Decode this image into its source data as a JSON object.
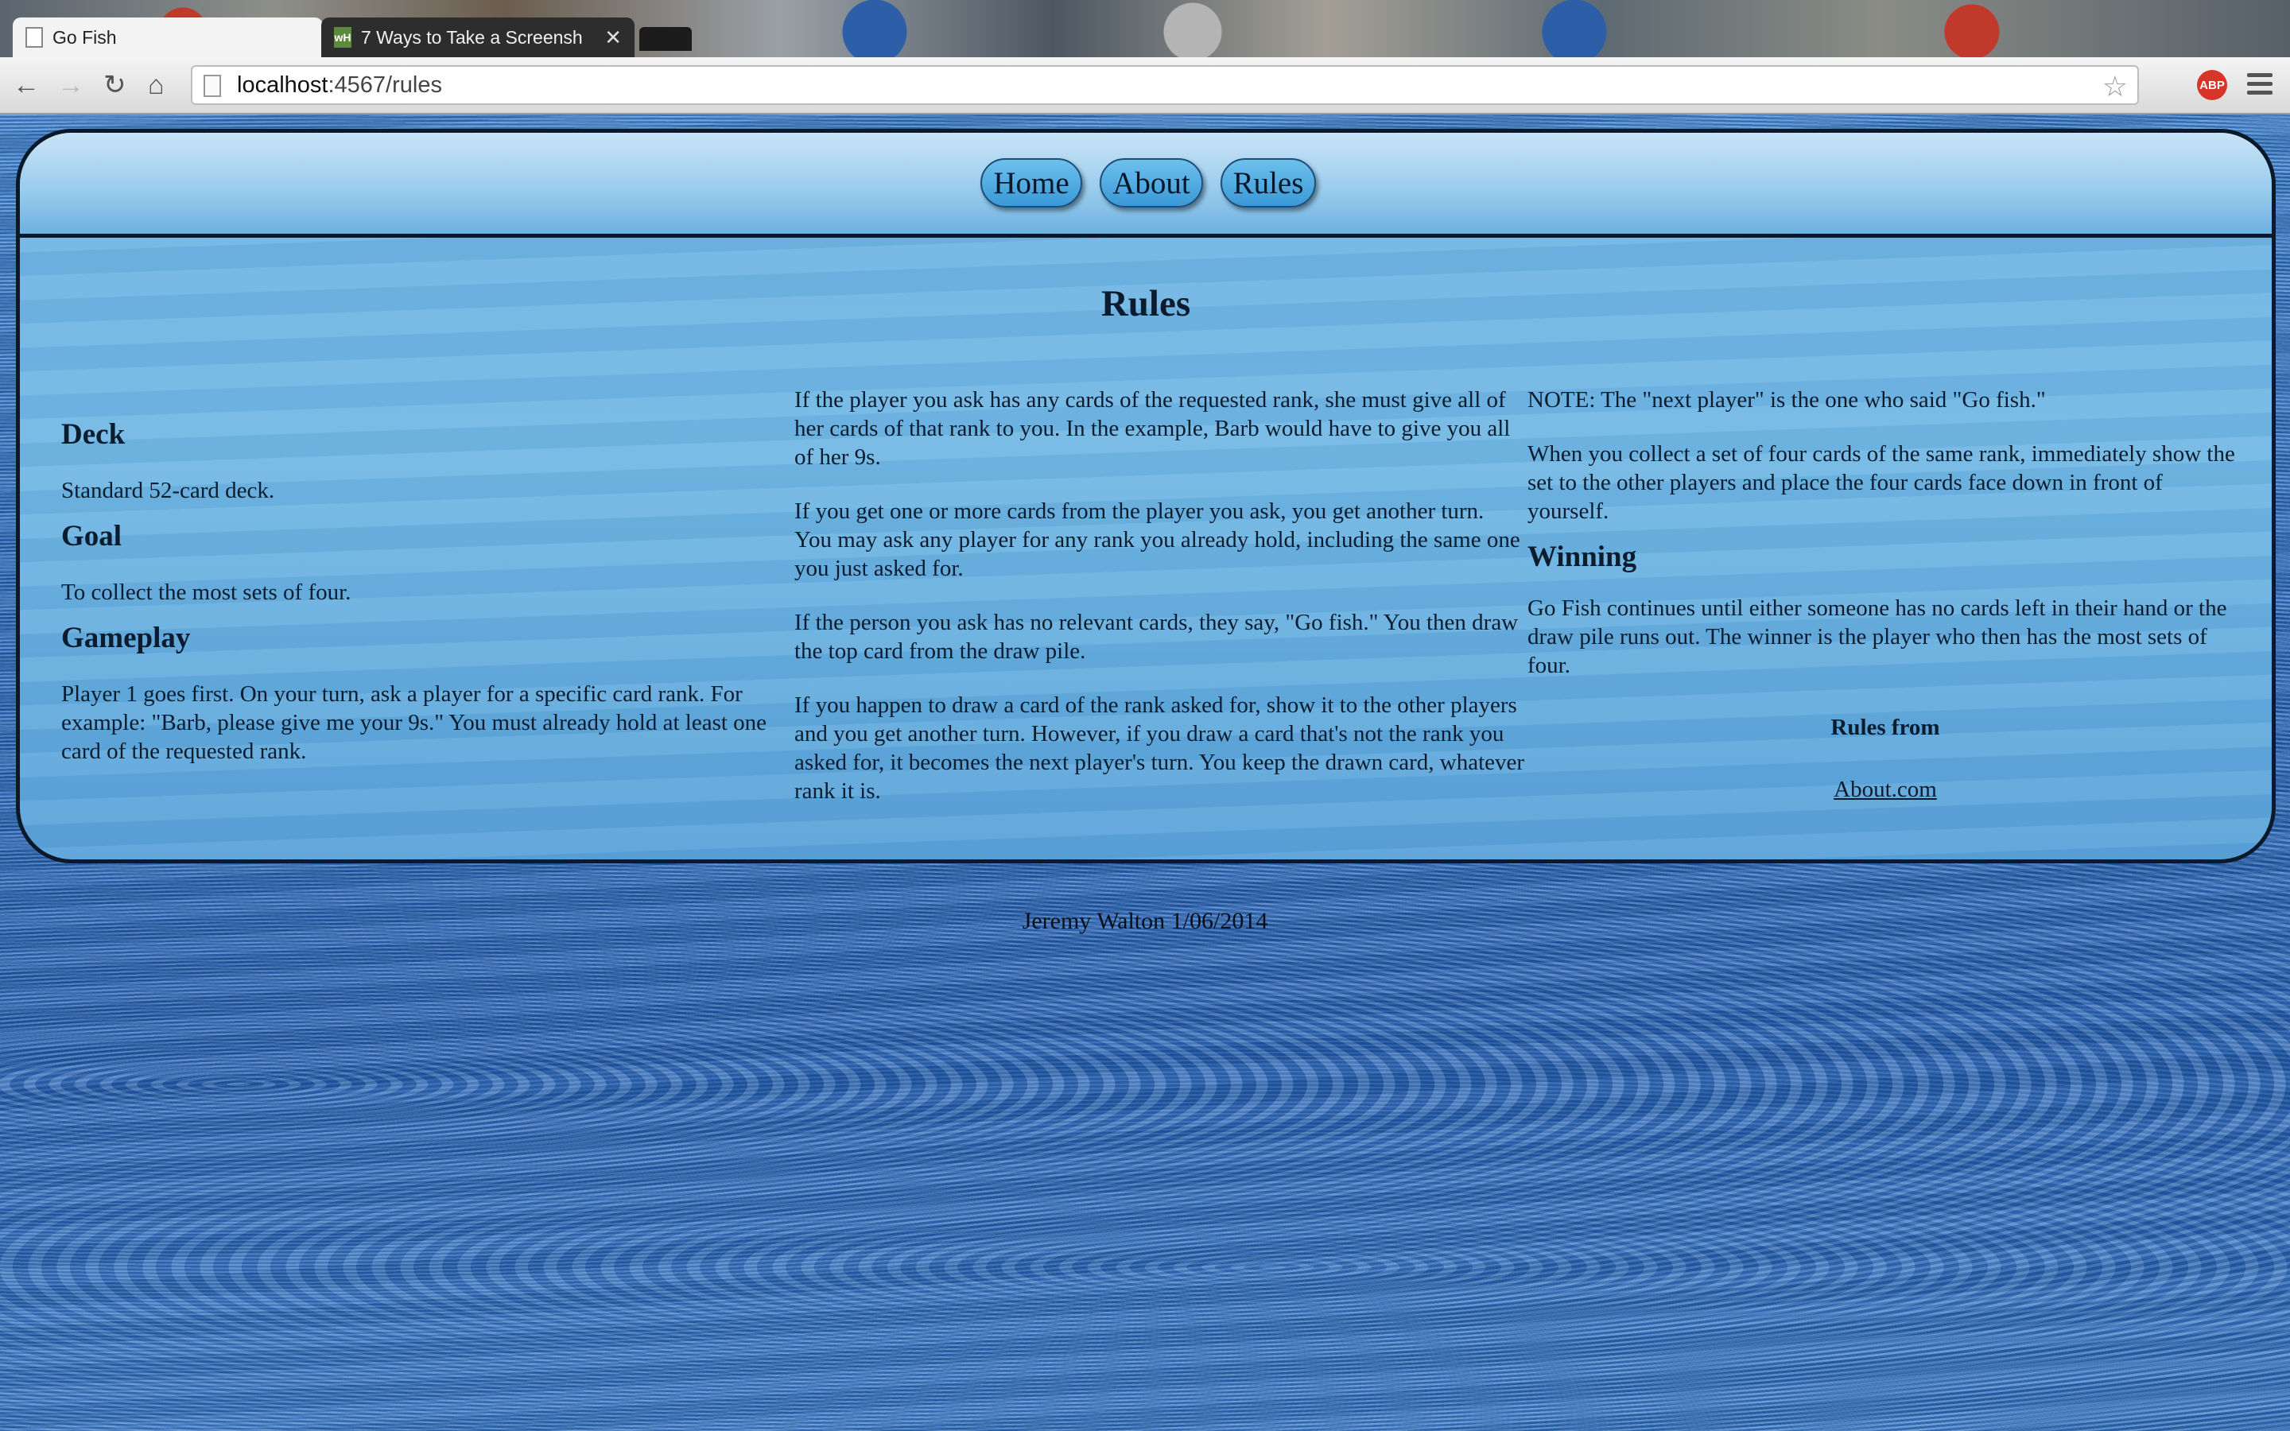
{
  "browser": {
    "tabs": [
      {
        "title": "Go Fish",
        "active": true
      },
      {
        "title": "7 Ways to Take a Screensh",
        "active": false
      }
    ],
    "url_host": "localhost",
    "url_path": ":4567/rules",
    "extension_badge": "ABP",
    "icons": {
      "back": "←",
      "forward": "→",
      "reload": "↻",
      "home": "⌂",
      "star": "☆",
      "close": "✕",
      "tab2_favicon": "wH"
    }
  },
  "nav": {
    "home": "Home",
    "about": "About",
    "rules": "Rules"
  },
  "content": {
    "title": "Rules",
    "deck_heading": "Deck",
    "deck_text": "Standard 52-card deck.",
    "goal_heading": "Goal",
    "goal_text": "To collect the most sets of four.",
    "gameplay_heading": "Gameplay",
    "gameplay_p1": "Player 1 goes first. On your turn, ask a player for a specific card rank. For example: \"Barb, please give me your 9s.\" You must already hold at least one card of the requested rank.",
    "gameplay_p2": "If the player you ask has any cards of the requested rank, she must give all of her cards of that rank to you. In the example, Barb would have to give you all of her 9s.",
    "gameplay_p3": "If you get one or more cards from the player you ask, you get another turn. You may ask any player for any rank you already hold, including the same one you just asked for.",
    "gameplay_p4": "If the person you ask has no relevant cards, they say, \"Go fish.\" You then draw the top card from the draw pile.",
    "gameplay_p5": "If you happen to draw a card of the rank asked for, show it to the other players and you get another turn. However, if you draw a card that's not the rank you asked for, it becomes the next player's turn. You keep the drawn card, whatever rank it is.",
    "note": "NOTE: The \"next player\" is the one who said \"Go fish.\"",
    "sets_text": "When you collect a set of four cards of the same rank, immediately show the set to the other players and place the four cards face down in front of yourself.",
    "winning_heading": "Winning",
    "winning_text": "Go Fish continues until either someone has no cards left in their hand or the draw pile runs out. The winner is the player who then has the most sets of four.",
    "rules_from": "Rules from",
    "source_link": "About.com"
  },
  "footer": "Jeremy Walton 1/06/2014"
}
